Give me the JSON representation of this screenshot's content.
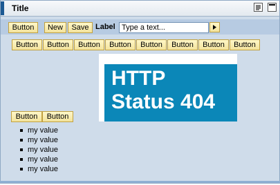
{
  "window": {
    "title": "Title"
  },
  "toolbar": {
    "button_label": "Button",
    "new_label": "New",
    "save_label": "Save",
    "field_label": "Label",
    "text_placeholder": "Type a text..."
  },
  "button_row": [
    "Button",
    "Button",
    "Button",
    "Button",
    "Button",
    "Button",
    "Button",
    "Button"
  ],
  "image": {
    "line1": "HTTP",
    "line2": "Status 404"
  },
  "lower_buttons": [
    "Button",
    "Button"
  ],
  "list_items": [
    "my value",
    "my value",
    "my value",
    "my value",
    "my value"
  ]
}
